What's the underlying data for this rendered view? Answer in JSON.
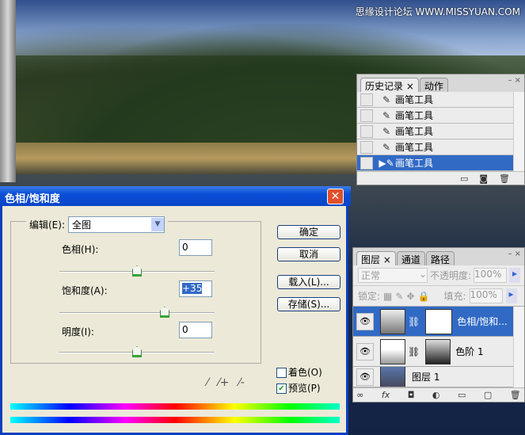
{
  "watermark": "思缘设计论坛 WWW.MISSYUAN.COM",
  "history_panel": {
    "tabs": [
      "历史记录",
      "动作"
    ],
    "items": [
      {
        "label": "画笔工具",
        "selected": false
      },
      {
        "label": "画笔工具",
        "selected": false
      },
      {
        "label": "画笔工具",
        "selected": false
      },
      {
        "label": "画笔工具",
        "selected": false
      },
      {
        "label": "画笔工具",
        "selected": true
      }
    ],
    "footer_icons": [
      "new-document-icon",
      "camera-icon",
      "trash-icon"
    ]
  },
  "dialog": {
    "title": "色相/饱和度",
    "edit_label": "编辑(E):",
    "edit_value": "全图",
    "hue_label": "色相(H):",
    "hue_value": "0",
    "saturation_label": "饱和度(A):",
    "saturation_value": "+35",
    "lightness_label": "明度(I):",
    "lightness_value": "0",
    "ok": "确定",
    "cancel": "取消",
    "load": "载入(L)...",
    "save": "存储(S)...",
    "colorize_label": "着色(O)",
    "colorize_checked": false,
    "preview_label": "预览(P)",
    "preview_checked": true
  },
  "layers_panel": {
    "tabs": [
      "图层",
      "通道",
      "路径"
    ],
    "blend_mode": "正常",
    "opacity_label": "不透明度:",
    "opacity_value": "100%",
    "lock_label": "锁定:",
    "fill_label": "填充:",
    "fill_value": "100%",
    "layers": [
      {
        "name": "色相/饱和...",
        "selected": true
      },
      {
        "name": "色阶 1",
        "selected": false
      },
      {
        "name": "图层 1",
        "selected": false
      }
    ],
    "footer_icons": [
      "link-icon",
      "fx-icon",
      "mask-icon",
      "adjustment-icon",
      "folder-icon",
      "new-layer-icon",
      "trash-icon"
    ]
  }
}
